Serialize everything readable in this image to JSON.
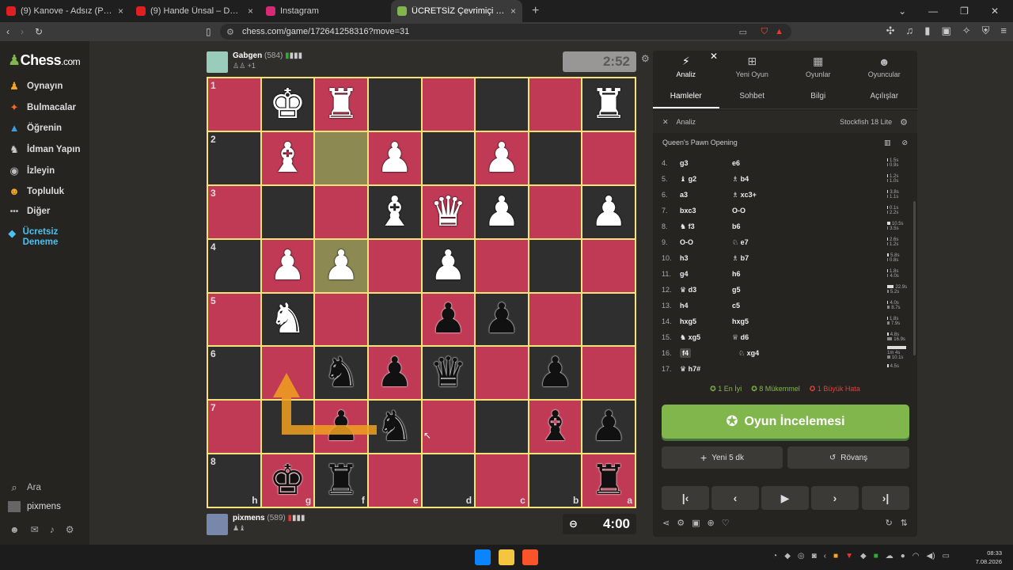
{
  "browser": {
    "tabs": [
      {
        "title": "(9) Kanove - Adsız (Prod.Kanove) - Yo",
        "color": "#e02020"
      },
      {
        "title": "(9) Hande Ünsal – Daha İyi - YouT",
        "color": "#e02020"
      },
      {
        "title": "Instagram",
        "color": "#d62976"
      },
      {
        "title": "ÜCRETSİZ Çevrimiçi Satranç Oyn",
        "color": "#81b64c"
      }
    ],
    "url": "chess.com/game/172641258316?move=31"
  },
  "sidebar": {
    "logo": "Chess",
    "logo_suffix": ".com",
    "items": [
      {
        "label": "Oynayın",
        "icon": "♟"
      },
      {
        "label": "Bulmacalar",
        "icon": "✦"
      },
      {
        "label": "Öğrenin",
        "icon": "▲"
      },
      {
        "label": "İdman Yapın",
        "icon": "♞"
      },
      {
        "label": "İzleyin",
        "icon": "◉"
      },
      {
        "label": "Topluluk",
        "icon": "☻"
      },
      {
        "label": "Diğer",
        "icon": "•••"
      },
      {
        "label": "Ücretsiz Deneme",
        "icon": "◆"
      }
    ],
    "search": "Ara",
    "user": "pixmens"
  },
  "game": {
    "top_player": {
      "name": "Gabgen",
      "rating": "(584)",
      "sub": "+1"
    },
    "bottom_player": {
      "name": "pixmens",
      "rating": "(589)"
    },
    "top_clock": "2:52",
    "bottom_clock": "4:00",
    "board": [
      [
        "",
        "wk",
        "wr",
        "",
        "",
        "",
        "",
        "wr"
      ],
      [
        "",
        "wb",
        "",
        "wp",
        "",
        "wp",
        "",
        ""
      ],
      [
        "",
        "",
        "",
        "wb",
        "wq",
        "wp",
        "",
        "wp"
      ],
      [
        "",
        "wp",
        "wp",
        "",
        "wp",
        "",
        "",
        ""
      ],
      [
        "",
        "wn",
        "",
        "",
        "bp",
        "bp",
        "",
        ""
      ],
      [
        "",
        "",
        "bn",
        "bp",
        "bq",
        "",
        "bp",
        ""
      ],
      [
        "",
        "",
        "bp",
        "bn",
        "",
        "",
        "bb",
        "bp"
      ],
      [
        "",
        "bk",
        "br",
        "",
        "",
        "",
        "",
        "br"
      ]
    ],
    "ranks": [
      "1",
      "2",
      "3",
      "4",
      "5",
      "6",
      "7",
      "8"
    ],
    "files": [
      "h",
      "g",
      "f",
      "e",
      "d",
      "c",
      "b",
      "a"
    ],
    "highlights": [
      [
        1,
        2
      ],
      [
        3,
        2
      ]
    ]
  },
  "panel": {
    "top_tabs": [
      {
        "label": "Analiz",
        "icon": "⚡"
      },
      {
        "label": "Yeni Oyun",
        "icon": "⊞"
      },
      {
        "label": "Oyunlar",
        "icon": "▦"
      },
      {
        "label": "Oyuncular",
        "icon": "☻"
      }
    ],
    "sub_tabs": [
      "Hamleler",
      "Sohbet",
      "Bilgi",
      "Açılışlar"
    ],
    "analysis_label": "Analiz",
    "engine": "Stockfish 18 Lite",
    "opening": "Queen's Pawn Opening",
    "moves": [
      {
        "n": "4.",
        "w": "g3",
        "b": "e6",
        "t1": "1.5s",
        "t2": "0.9s"
      },
      {
        "n": "5.",
        "w": "♝ g2",
        "b": "♗ b4",
        "t1": "1.2s",
        "t2": "1.0s"
      },
      {
        "n": "6.",
        "w": "a3",
        "b": "♗ xc3+",
        "t1": "3.8s",
        "t2": "1.1s"
      },
      {
        "n": "7.",
        "w": "bxc3",
        "b": "O-O",
        "t1": "0.1s",
        "t2": "2.2s"
      },
      {
        "n": "8.",
        "w": "♞ f3",
        "b": "b6",
        "t1": "10.5s",
        "t2": "3.5s"
      },
      {
        "n": "9.",
        "w": "O-O",
        "b": "♘ e7",
        "t1": "2.6s",
        "t2": "1.2s"
      },
      {
        "n": "10.",
        "w": "h3",
        "b": "♗ b7",
        "t1": "5.8s",
        "t2": "0.8s"
      },
      {
        "n": "11.",
        "w": "g4",
        "b": "h6",
        "t1": "1.8s",
        "t2": "4.0s"
      },
      {
        "n": "12.",
        "w": "♛ d3",
        "b": "g5",
        "t1": "22.9s",
        "t2": "5.2s"
      },
      {
        "n": "13.",
        "w": "h4",
        "b": "c5",
        "t1": "4.0s",
        "t2": "8.7s"
      },
      {
        "n": "14.",
        "w": "hxg5",
        "b": "hxg5",
        "t1": "1.8s",
        "t2": "7.9s"
      },
      {
        "n": "15.",
        "w": "♞ xg5",
        "b": "♕ d6",
        "t1": "4.8s",
        "t2": "16.9s"
      },
      {
        "n": "16.",
        "w": "f4",
        "b": "♘ xg4",
        "t1": "1m 4s",
        "t2": "10.1s"
      },
      {
        "n": "17.",
        "w": "♛ h7#",
        "b": "",
        "t1": "4.5s",
        "t2": ""
      }
    ],
    "summary": [
      {
        "label": "1 En İyi",
        "color": "#81b64c"
      },
      {
        "label": "8 Mükemmel",
        "color": "#81b64c"
      },
      {
        "label": "1 Büyük Hata",
        "color": "#e0413c"
      }
    ],
    "review_button": "Oyun İncelemesi",
    "new_game_button": "Yeni 5 dk",
    "rematch_button": "Rövanş"
  },
  "taskbar": {
    "time": "08:33",
    "date": "7.08.2026"
  }
}
